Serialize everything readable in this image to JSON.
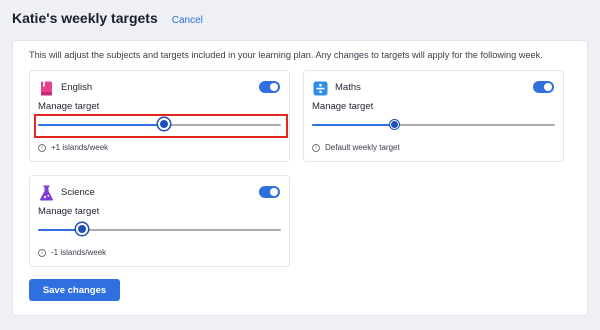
{
  "header": {
    "title": "Katie's weekly targets",
    "cancel_label": "Cancel"
  },
  "intro_text": "This will adjust the subjects and targets included in your learning plan. Any changes to targets will apply for the following week.",
  "subjects": [
    {
      "name": "English",
      "icon": "book-icon",
      "icon_color": "#e8418c",
      "enabled": true,
      "manage_label": "Manage target",
      "slider_value_fraction": 0.52,
      "info_text": "+1 islands/week"
    },
    {
      "name": "Maths",
      "icon": "division-icon",
      "icon_color": "#2f8fe6",
      "enabled": true,
      "manage_label": "Manage target",
      "slider_value_fraction": 0.34,
      "info_text": "Default weekly target"
    },
    {
      "name": "Science",
      "icon": "flask-icon",
      "icon_color": "#7a3fd6",
      "enabled": true,
      "manage_label": "Manage target",
      "slider_value_fraction": 0.18,
      "info_text": "-1 islands/week"
    }
  ],
  "save_label": "Save changes",
  "colors": {
    "accent": "#2f6fe0",
    "highlight": "#e0281e",
    "background": "#eef0f5"
  }
}
